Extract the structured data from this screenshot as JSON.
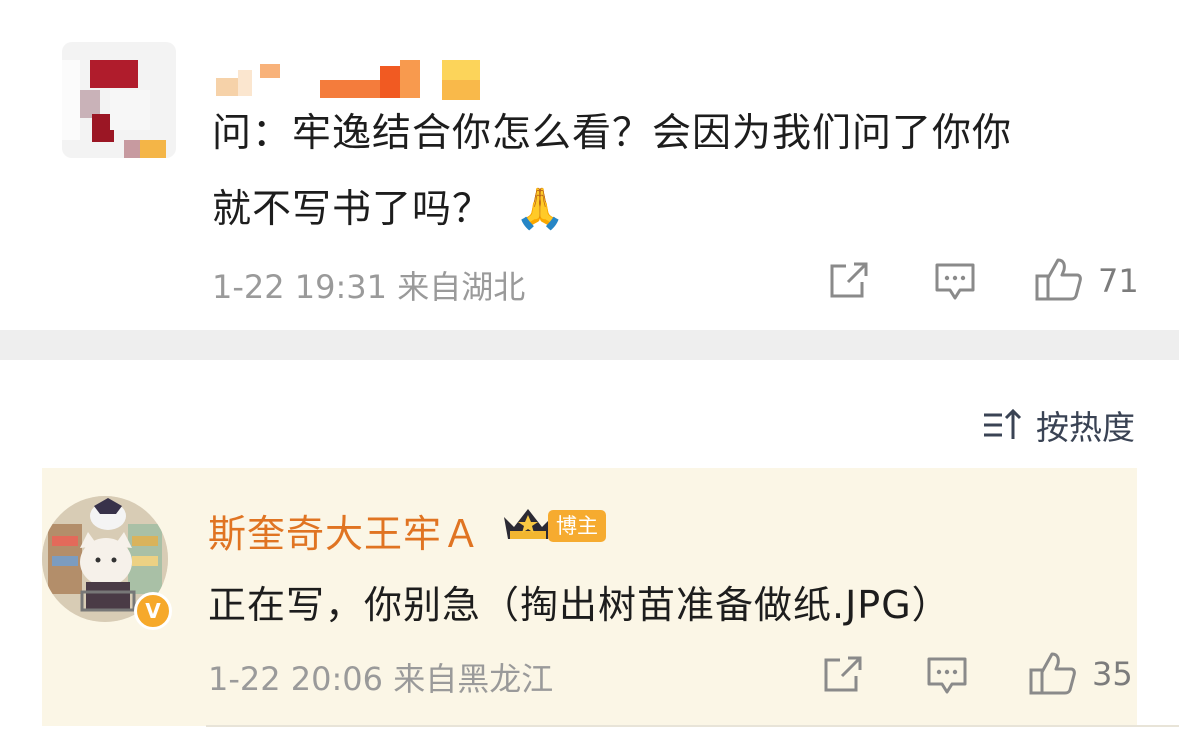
{
  "post": {
    "text_line1": "问：牢逸结合你怎么看？会因为我们问了你你",
    "text_line2": "就不写书了吗？",
    "emoji": "🙏",
    "meta": "1-22 19:31 来自湖北",
    "like_count": "71"
  },
  "sort": {
    "label": "按热度"
  },
  "comment": {
    "author": "斯奎奇大王牢Ａ",
    "badge": "博主",
    "verify": "V",
    "text": "正在写，你别急（掏出树苗准备做纸.JPG）",
    "meta": "1-22 20:06 来自黑龙江",
    "like_count": "35"
  },
  "icons": {
    "share": "share-icon",
    "comment": "comment-icon",
    "like": "thumbs-up-icon",
    "sort": "sort-icon",
    "crown": "crown-icon"
  },
  "colors": {
    "author": "#e07422",
    "badge": "#f6ab2f",
    "comment_bg": "#fbf6e6",
    "divider": "#eeeeee"
  }
}
